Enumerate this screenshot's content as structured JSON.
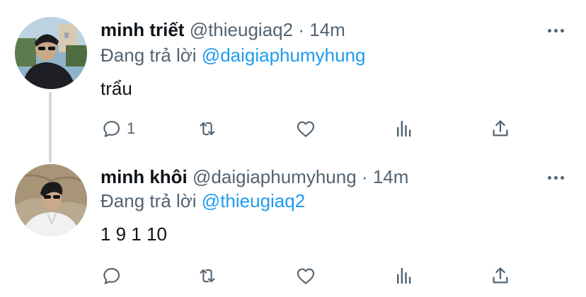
{
  "colors": {
    "accent": "#1d9bf0",
    "secondary_text": "#536471",
    "primary_text": "#0f1419",
    "thread_line": "#cfd9de"
  },
  "tweets": [
    {
      "author_name": "minh triết",
      "handle": "@thieugiaq2",
      "separator": "·",
      "time": "14m",
      "replying_prefix": "Đang trả lời",
      "replying_to": "@daigiaphumyhung",
      "text": "trẩu",
      "reply_count": "1",
      "retweet_count": "",
      "like_count": "",
      "icons": [
        "reply-icon",
        "retweet-icon",
        "like-icon",
        "views-icon",
        "share-icon",
        "more-icon"
      ]
    },
    {
      "author_name": "minh khôi",
      "handle": "@daigiaphumyhung",
      "separator": "·",
      "time": "14m",
      "replying_prefix": "Đang trả lời",
      "replying_to": "@thieugiaq2",
      "text": "1 9 1 10",
      "reply_count": "",
      "retweet_count": "",
      "like_count": "",
      "icons": [
        "reply-icon",
        "retweet-icon",
        "like-icon",
        "views-icon",
        "share-icon",
        "more-icon"
      ]
    }
  ]
}
